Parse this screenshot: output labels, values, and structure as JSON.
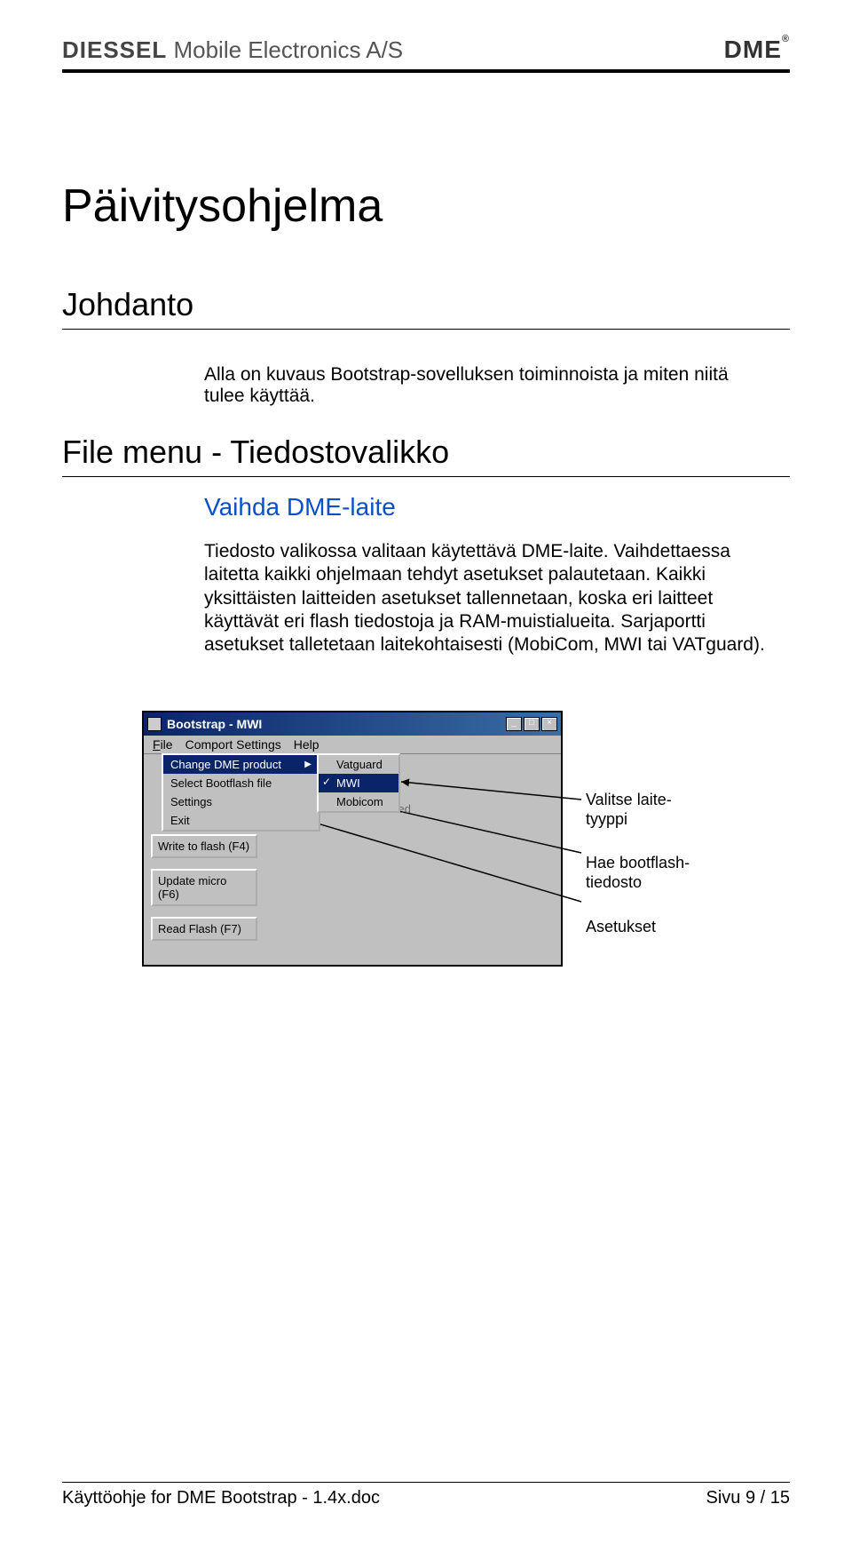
{
  "header": {
    "brand_left_a": "DIESSEL",
    "brand_left_b": " Mobile Electronics A/S",
    "brand_right": "DME",
    "reg": "®"
  },
  "title": "Päivitysohjelma",
  "section1": {
    "heading": "Johdanto",
    "text": "Alla on kuvaus Bootstrap-sovelluksen toiminnoista ja miten niitä tulee käyttää."
  },
  "section2": {
    "heading": "File menu - Tiedostovalikko",
    "subheading": "Vaihda DME-laite",
    "body": "Tiedosto valikossa valitaan käytettävä DME-laite. Vaihdettaessa laitetta kaikki ohjelmaan tehdyt asetukset palautetaan. Kaikki yksittäisten laitteiden asetukset tallennetaan, koska eri laitteet käyttävät eri flash tiedostoja ja RAM-muistialueita. Sarjaportti asetukset talletetaan laitekohtaisesti (MobiCom, MWI tai VATguard)."
  },
  "screenshot": {
    "window_title": "Bootstrap - MWI",
    "menus": {
      "file": "File",
      "comport": "Comport Settings",
      "help": "Help"
    },
    "file_menu": {
      "item0": "Change DME product",
      "item1": "Select Bootflash file",
      "item2": "Settings",
      "item3": "Exit"
    },
    "submenu": {
      "item0": "Vatguard",
      "item1": "MWI",
      "item2": "Mobicom"
    },
    "bg_button": "ced",
    "side_buttons": {
      "b1": "Write to flash (F4)",
      "b2": "Update micro (F6)",
      "b3": "Read Flash (F7)"
    },
    "winbtns": {
      "min": "_",
      "max": "□",
      "close": "×"
    }
  },
  "callouts": {
    "c1": "Valitse laite-tyyppi",
    "c2": "Hae bootflash-tiedosto",
    "c3": "Asetukset"
  },
  "footer": {
    "left": "Käyttöohje for DME Bootstrap - 1.4x.doc",
    "right": "Sivu 9 / 15"
  }
}
